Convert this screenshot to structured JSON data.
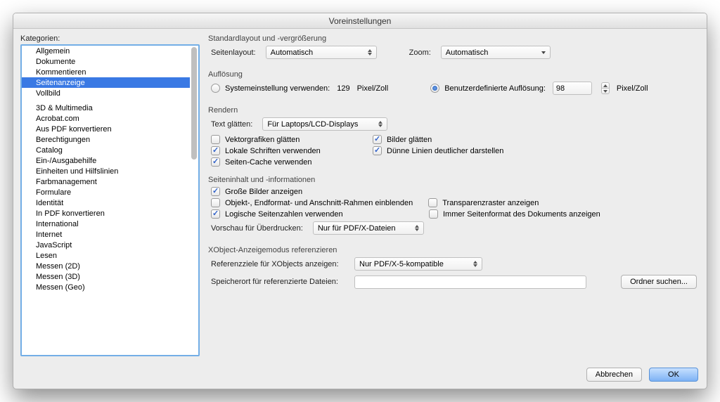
{
  "window": {
    "title": "Voreinstellungen"
  },
  "sidebar": {
    "label": "Kategorien:",
    "group1": [
      {
        "label": "Allgemein"
      },
      {
        "label": "Dokumente"
      },
      {
        "label": "Kommentieren"
      },
      {
        "label": "Seitenanzeige",
        "selected": true
      },
      {
        "label": "Vollbild"
      }
    ],
    "group2": [
      {
        "label": "3D & Multimedia"
      },
      {
        "label": "Acrobat.com"
      },
      {
        "label": "Aus PDF konvertieren"
      },
      {
        "label": "Berechtigungen"
      },
      {
        "label": "Catalog"
      },
      {
        "label": "Ein-/Ausgabehilfe"
      },
      {
        "label": "Einheiten und Hilfslinien"
      },
      {
        "label": "Farbmanagement"
      },
      {
        "label": "Formulare"
      },
      {
        "label": "Identität"
      },
      {
        "label": "In PDF konvertieren"
      },
      {
        "label": "International"
      },
      {
        "label": "Internet"
      },
      {
        "label": "JavaScript"
      },
      {
        "label": "Lesen"
      },
      {
        "label": "Messen (2D)"
      },
      {
        "label": "Messen (3D)"
      },
      {
        "label": "Messen (Geo)"
      }
    ]
  },
  "sections": {
    "layout": {
      "title": "Standardlayout und -vergrößerung",
      "seitenlayout_label": "Seitenlayout:",
      "seitenlayout_value": "Automatisch",
      "zoom_label": "Zoom:",
      "zoom_value": "Automatisch"
    },
    "resolution": {
      "title": "Auflösung",
      "system_label": "Systemeinstellung verwenden:",
      "system_value": "129",
      "unit": "Pixel/Zoll",
      "custom_label": "Benutzerdefinierte Auflösung:",
      "custom_value": "98"
    },
    "render": {
      "title": "Rendern",
      "smooth_label": "Text glätten:",
      "smooth_value": "Für Laptops/LCD-Displays",
      "cb": {
        "vector": "Vektorgrafiken glätten",
        "images": "Bilder glätten",
        "localfonts": "Lokale Schriften verwenden",
        "thinlines": "Dünne Linien deutlicher darstellen",
        "pagecache": "Seiten-Cache verwenden"
      }
    },
    "pageinfo": {
      "title": "Seiteninhalt und -informationen",
      "cb": {
        "largeimg": "Große Bilder anzeigen",
        "frames": "Objekt-, Endformat- und Anschnitt-Rahmen einblenden",
        "transparency": "Transparenzraster anzeigen",
        "logical": "Logische Seitenzahlen verwenden",
        "always": "Immer Seitenformat des Dokuments anzeigen"
      },
      "overprint_label": "Vorschau für Überdrucken:",
      "overprint_value": "Nur für PDF/X-Dateien"
    },
    "xobject": {
      "title": "XObject-Anzeigemodus referenzieren",
      "targets_label": "Referenzziele für XObjects anzeigen:",
      "targets_value": "Nur PDF/X-5-kompatible",
      "location_label": "Speicherort für referenzierte Dateien:",
      "browse_btn": "Ordner suchen..."
    }
  },
  "footer": {
    "cancel": "Abbrechen",
    "ok": "OK"
  }
}
